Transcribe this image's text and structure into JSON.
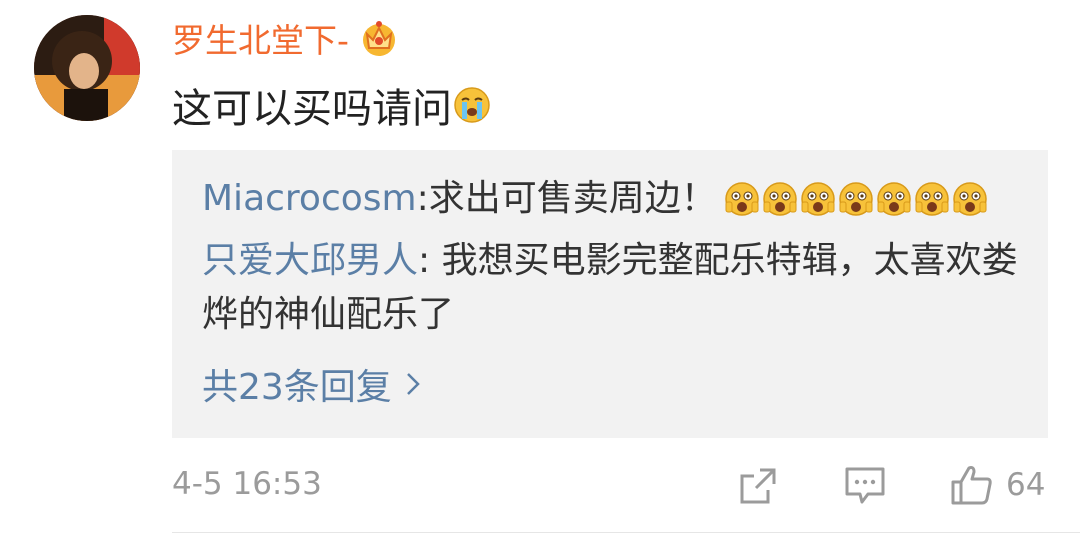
{
  "comment": {
    "username": "罗生北堂下-",
    "text": "这可以买吗请问",
    "emoji": "crying-emoji",
    "timestamp": "4-5 16:53",
    "like_count": "64"
  },
  "replies": [
    {
      "name": "Miacrocosm",
      "separator": ": ",
      "text": "求出可售卖周边！",
      "emoji": "scared-emoji",
      "emoji_count": 7
    },
    {
      "name": "只爱大邱男人",
      "separator": ": ",
      "text": "我想买电影完整配乐特辑，太喜欢娄烨的神仙配乐了"
    }
  ],
  "reply_summary": "共23条回复",
  "colors": {
    "username": "#f16a2f",
    "reply_name": "#5b7fa6",
    "reply_bg": "#f2f2f2",
    "meta_gray": "#9b9b9b",
    "emoji_yellow": "#f7c23a"
  },
  "icons": [
    "vip-crown-icon",
    "share-icon",
    "comment-icon",
    "thumbs-up-icon",
    "chevron-right-icon"
  ]
}
